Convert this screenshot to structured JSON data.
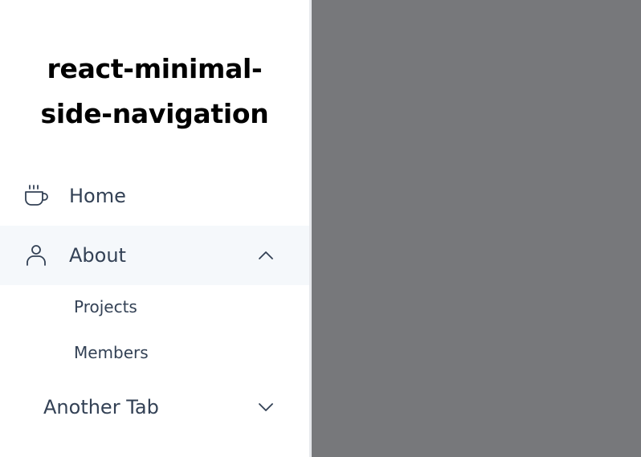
{
  "sidebar": {
    "title": "react-minimal-side-navigation",
    "title_line1": "react-minimal-",
    "title_line2": "side-navigation",
    "items": [
      {
        "label": "Home",
        "icon": "coffee-cup-icon"
      },
      {
        "label": "About",
        "icon": "user-icon",
        "expanded": true,
        "subitems": [
          {
            "label": "Projects"
          },
          {
            "label": "Members"
          }
        ]
      },
      {
        "label": "Another Tab",
        "expanded": false
      }
    ]
  },
  "colors": {
    "sidebar_bg": "#ffffff",
    "active_bg": "#f5f8fb",
    "overlay": "#77787b",
    "text": "#334155"
  }
}
